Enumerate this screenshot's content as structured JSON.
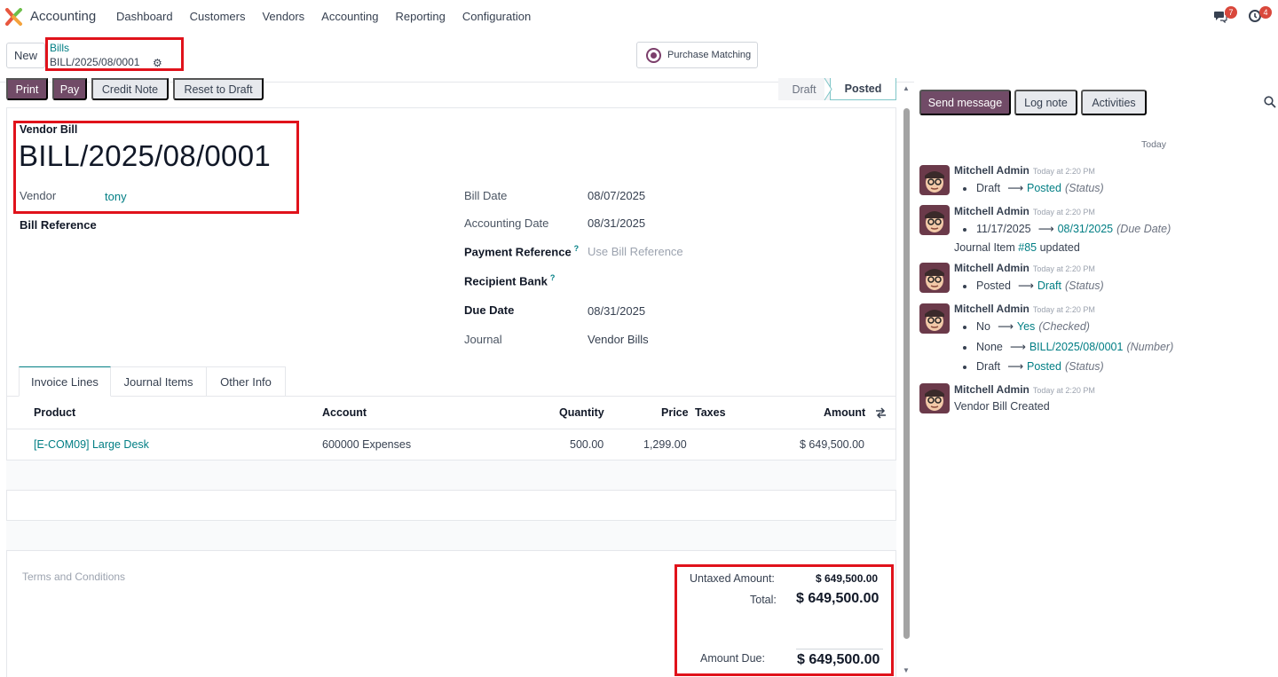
{
  "navbar": {
    "app_name": "Accounting",
    "menu": [
      "Dashboard",
      "Customers",
      "Vendors",
      "Accounting",
      "Reporting",
      "Configuration"
    ],
    "messages_count": "7",
    "activities_count": "4"
  },
  "control": {
    "new_label": "New",
    "breadcrumb_parent": "Bills",
    "breadcrumb_current": "BILL/2025/08/0001",
    "purchase_matching_label": "Purchase Matching"
  },
  "actions": {
    "print": "Print",
    "pay": "Pay",
    "credit_note": "Credit Note",
    "reset_to_draft": "Reset to Draft"
  },
  "status": {
    "draft": "Draft",
    "posted": "Posted",
    "current": "Posted"
  },
  "form": {
    "type_label": "Vendor Bill",
    "number": "BILL/2025/08/0001",
    "vendor_label": "Vendor",
    "vendor_value": "tony",
    "bill_reference_label": "Bill Reference",
    "bill_date_label": "Bill Date",
    "bill_date_value": "08/07/2025",
    "accounting_date_label": "Accounting Date",
    "accounting_date_value": "08/31/2025",
    "payment_reference_label": "Payment Reference",
    "payment_reference_placeholder": "Use Bill Reference",
    "recipient_bank_label": "Recipient Bank",
    "due_date_label": "Due Date",
    "due_date_value": "08/31/2025",
    "journal_label": "Journal",
    "journal_value": "Vendor Bills",
    "help_mark": "?"
  },
  "tabs": [
    "Invoice Lines",
    "Journal Items",
    "Other Info"
  ],
  "lines": {
    "headers": {
      "product": "Product",
      "account": "Account",
      "quantity": "Quantity",
      "price": "Price",
      "taxes": "Taxes",
      "amount": "Amount"
    },
    "rows": [
      {
        "product": "[E-COM09] Large Desk",
        "account": "600000 Expenses",
        "quantity": "500.00",
        "price": "1,299.00",
        "taxes": "",
        "amount": "$ 649,500.00"
      }
    ]
  },
  "terms_placeholder": "Terms and Conditions",
  "totals": {
    "untaxed_label": "Untaxed Amount:",
    "untaxed_value": "$ 649,500.00",
    "total_label": "Total:",
    "total_value": "$ 649,500.00",
    "amount_due_label": "Amount Due:",
    "amount_due_value": "$ 649,500.00"
  },
  "chatter": {
    "send_message": "Send message",
    "log_note": "Log note",
    "activities": "Activities",
    "date_separator": "Today",
    "messages": [
      {
        "author": "Mitchell Admin",
        "time": "Today at 2:20 PM",
        "changes": [
          {
            "old": "Draft",
            "new": "Posted",
            "field": "(Status)"
          }
        ]
      },
      {
        "author": "Mitchell Admin",
        "time": "Today at 2:20 PM",
        "changes": [
          {
            "old": "11/17/2025",
            "new": "08/31/2025",
            "field": "(Due Date)"
          }
        ],
        "note_prefix": "Journal Item",
        "note_link": "#85",
        "note_suffix": "updated"
      },
      {
        "author": "Mitchell Admin",
        "time": "Today at 2:20 PM",
        "changes": [
          {
            "old": "Posted",
            "new": "Draft",
            "field": "(Status)"
          }
        ]
      },
      {
        "author": "Mitchell Admin",
        "time": "Today at 2:20 PM",
        "changes": [
          {
            "old": "No",
            "new": "Yes",
            "field": "(Checked)"
          },
          {
            "old": "None",
            "new": "BILL/2025/08/0001",
            "field": "(Number)"
          },
          {
            "old": "Draft",
            "new": "Posted",
            "field": "(Status)"
          }
        ]
      },
      {
        "author": "Mitchell Admin",
        "time": "Today at 2:20 PM",
        "body": "Vendor Bill Created"
      }
    ]
  },
  "colors": {
    "primary": "#714b67",
    "link": "#017e84",
    "highlight": "#e0121b",
    "badge": "#d9473b"
  }
}
